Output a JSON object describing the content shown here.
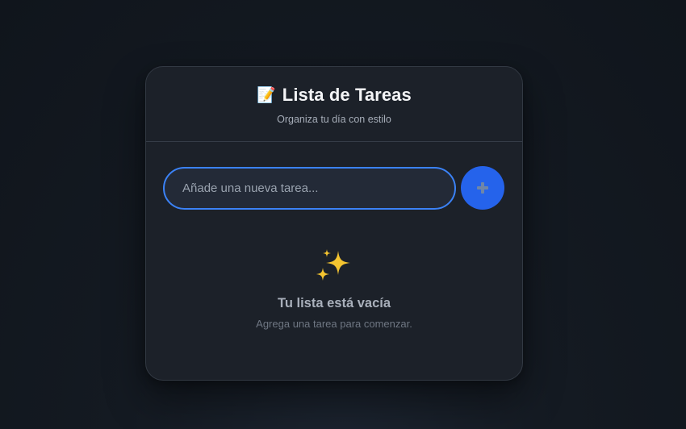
{
  "header": {
    "icon": "memo-icon",
    "icon_glyph": "📝",
    "title": "Lista de Tareas",
    "subtitle": "Organiza tu día con estilo"
  },
  "input": {
    "placeholder": "Añade una nueva tarea...",
    "value": ""
  },
  "add_button": {
    "icon": "plus-icon"
  },
  "empty_state": {
    "icon": "sparkles-icon",
    "title": "Tu lista está vacía",
    "subtitle": "Agrega una tarea para comenzar."
  },
  "colors": {
    "accent": "#2563eb",
    "input_border": "#3b82f6",
    "card_bg": "#1c2129",
    "page_bg": "#141a22",
    "sparkle": "#f4c430"
  }
}
